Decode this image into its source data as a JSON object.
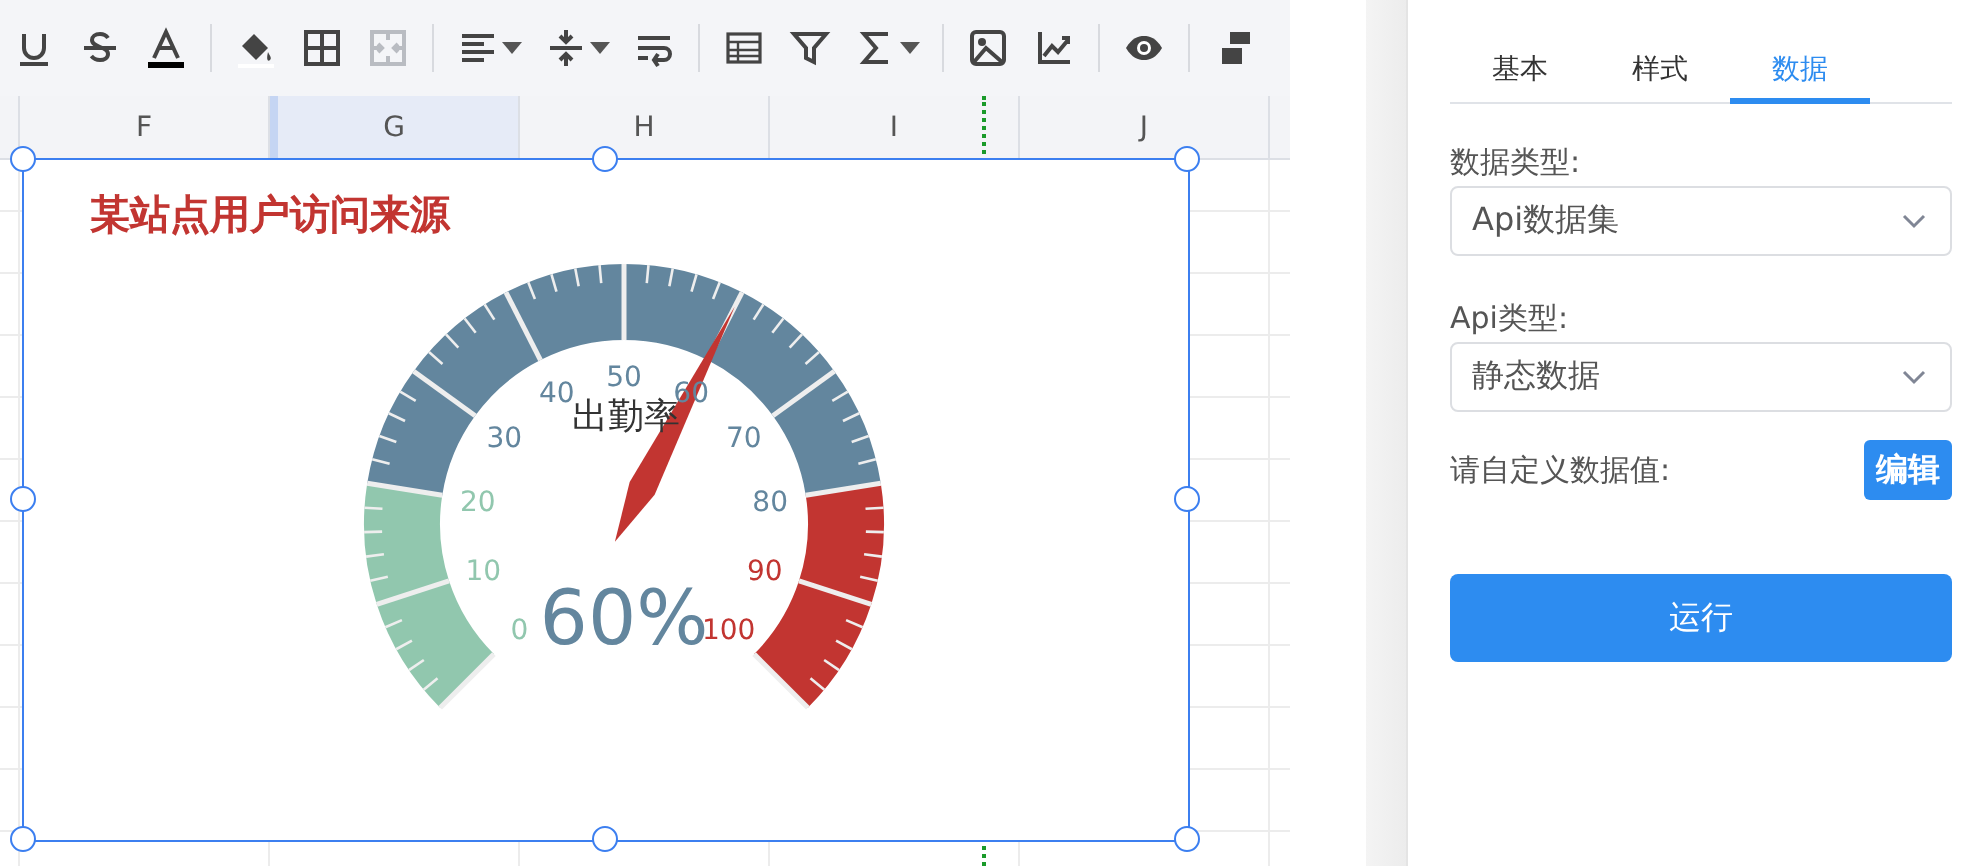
{
  "toolbar": [
    {
      "kind": "underline",
      "disabled": false,
      "dropdown": false
    },
    {
      "kind": "strikethrough",
      "disabled": false,
      "dropdown": false
    },
    {
      "kind": "font-color",
      "disabled": false,
      "dropdown": false
    },
    {
      "kind": "separator"
    },
    {
      "kind": "fill-color",
      "disabled": false,
      "dropdown": false
    },
    {
      "kind": "borders",
      "disabled": false,
      "dropdown": false
    },
    {
      "kind": "merge",
      "disabled": true,
      "dropdown": false
    },
    {
      "kind": "separator"
    },
    {
      "kind": "align",
      "disabled": false,
      "dropdown": true
    },
    {
      "kind": "valign",
      "disabled": false,
      "dropdown": true
    },
    {
      "kind": "wrap",
      "disabled": false,
      "dropdown": false
    },
    {
      "kind": "separator"
    },
    {
      "kind": "table",
      "disabled": false,
      "dropdown": false
    },
    {
      "kind": "filter",
      "disabled": false,
      "dropdown": false
    },
    {
      "kind": "sum",
      "disabled": false,
      "dropdown": true
    },
    {
      "kind": "separator"
    },
    {
      "kind": "image",
      "disabled": false,
      "dropdown": false
    },
    {
      "kind": "chart",
      "disabled": false,
      "dropdown": false
    },
    {
      "kind": "separator"
    },
    {
      "kind": "eye",
      "disabled": false,
      "dropdown": false
    },
    {
      "kind": "separator"
    },
    {
      "kind": "brush",
      "disabled": false,
      "dropdown": false
    }
  ],
  "columns": [
    {
      "label": "F",
      "selected": false
    },
    {
      "label": "G",
      "selected": true
    },
    {
      "label": "H",
      "selected": false
    },
    {
      "label": "I",
      "selected": false
    },
    {
      "label": "J",
      "selected": false
    }
  ],
  "chart_widget": {
    "title": "某站点用户访问来源",
    "selected": true,
    "gauge": {
      "name": "出勤率",
      "value_text": "60%",
      "level": 0.6,
      "tick_labels": [
        {
          "text": "0",
          "color": "#91c7ae"
        },
        {
          "text": "10",
          "color": "#91c7ae"
        },
        {
          "text": "20",
          "color": "#91c7ae"
        },
        {
          "text": "30",
          "color": "#63869e"
        },
        {
          "text": "40",
          "color": "#63869e"
        },
        {
          "text": "50",
          "color": "#63869e"
        },
        {
          "text": "60",
          "color": "#63869e"
        },
        {
          "text": "70",
          "color": "#63869e"
        },
        {
          "text": "80",
          "color": "#63869e"
        },
        {
          "text": "90",
          "color": "#c23531"
        },
        {
          "text": "100",
          "color": "#c23531"
        }
      ]
    }
  },
  "panel": {
    "tabs": [
      {
        "label": "基本",
        "selected": false
      },
      {
        "label": "样式",
        "selected": false
      },
      {
        "label": "数据",
        "selected": true
      }
    ],
    "fields": [
      {
        "label": "数据类型:",
        "value": "Api数据集"
      },
      {
        "label": "Api类型:",
        "value": "静态数据"
      }
    ],
    "custom_label": "请自定义数据值:",
    "edit_button": "编辑",
    "run_button": "运行"
  }
}
